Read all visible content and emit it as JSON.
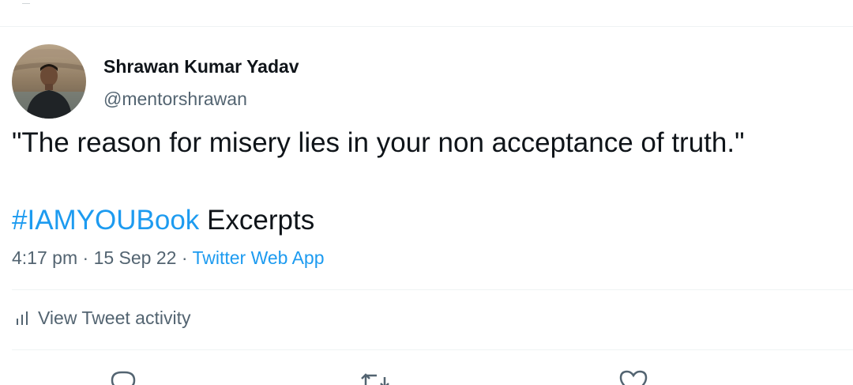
{
  "tweet": {
    "author": {
      "display_name": "Shrawan Kumar Yadav",
      "handle": "@mentorshrawan",
      "avatar_icon": "profile-photo"
    },
    "text_line1": "\"The reason for misery lies in your non acceptance of truth.\"",
    "hashtag": "#IAMYOUBook",
    "text_after_hashtag": " Excerpts",
    "time": "4:17 pm",
    "separator": " · ",
    "date": "15 Sep 22",
    "source": "Twitter Web App"
  },
  "activity": {
    "label": "View Tweet activity",
    "icon": "bar-chart-icon"
  },
  "actions": {
    "icons": [
      "reply-icon",
      "retweet-icon",
      "like-icon"
    ]
  },
  "colors": {
    "link": "#1d9bf0",
    "text_primary": "#0f1419",
    "text_secondary": "#536471",
    "divider": "#eff3f4"
  }
}
